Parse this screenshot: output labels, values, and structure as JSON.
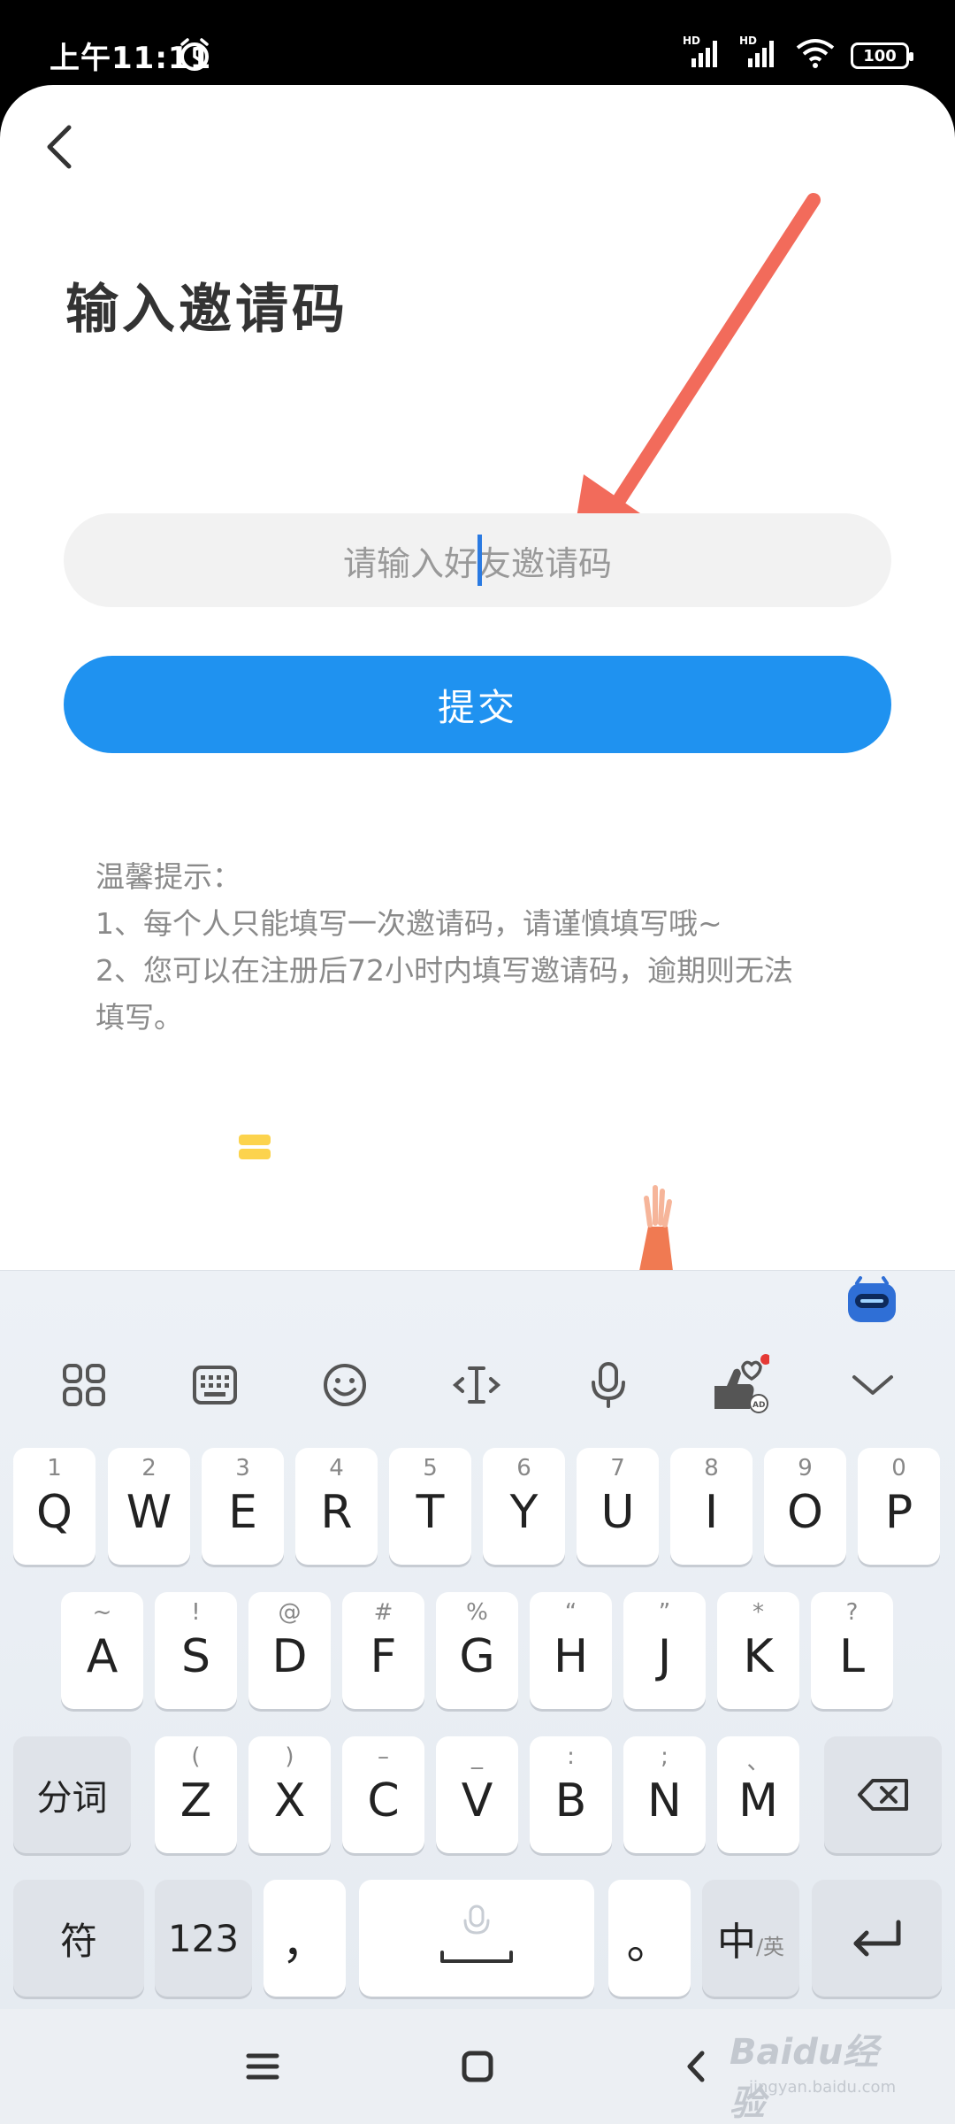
{
  "status_bar": {
    "time": "上午11:11",
    "battery": "100"
  },
  "page": {
    "title": "输入邀请码",
    "input_placeholder": "请输入好友邀请码",
    "submit_label": "提交",
    "tips": [
      "温馨提示：",
      "1、每个人只能填写一次邀请码，请谨慎填写哦~",
      "2、您可以在注册后72小时内填写邀请码，逾期则无法",
      "填写。"
    ]
  },
  "keyboard": {
    "toolbar_icons": [
      "apps-grid-icon",
      "keyboard-icon",
      "emoji-icon",
      "cursor-move-icon",
      "microphone-icon",
      "skin-ad-icon",
      "collapse-chevron-icon"
    ],
    "row1": [
      {
        "hint": "1",
        "key": "Q"
      },
      {
        "hint": "2",
        "key": "W"
      },
      {
        "hint": "3",
        "key": "E"
      },
      {
        "hint": "4",
        "key": "R"
      },
      {
        "hint": "5",
        "key": "T"
      },
      {
        "hint": "6",
        "key": "Y"
      },
      {
        "hint": "7",
        "key": "U"
      },
      {
        "hint": "8",
        "key": "I"
      },
      {
        "hint": "9",
        "key": "O"
      },
      {
        "hint": "0",
        "key": "P"
      }
    ],
    "row2": [
      {
        "hint": "~",
        "key": "A"
      },
      {
        "hint": "!",
        "key": "S"
      },
      {
        "hint": "@",
        "key": "D"
      },
      {
        "hint": "#",
        "key": "F"
      },
      {
        "hint": "%",
        "key": "G"
      },
      {
        "hint": "“",
        "key": "H"
      },
      {
        "hint": "”",
        "key": "J"
      },
      {
        "hint": "*",
        "key": "K"
      },
      {
        "hint": "?",
        "key": "L"
      }
    ],
    "row3": [
      {
        "hint": "(",
        "key": "Z"
      },
      {
        "hint": ")",
        "key": "X"
      },
      {
        "hint": "–",
        "key": "C"
      },
      {
        "hint": "_",
        "key": "V"
      },
      {
        "hint": ":",
        "key": "B"
      },
      {
        "hint": ";",
        "key": "N"
      },
      {
        "hint": "、",
        "key": "M"
      }
    ],
    "fenci_label": "分词",
    "symbol_label": "符",
    "numbers_label": "123",
    "comma_label": "，",
    "period_label": "。",
    "lang_main": "中",
    "lang_alt": "/英"
  },
  "watermark": {
    "text": "Baidu经验",
    "url": "jingyan.baidu.com"
  },
  "colors": {
    "accent": "#1f92f0",
    "arrow": "#f26b5b"
  }
}
